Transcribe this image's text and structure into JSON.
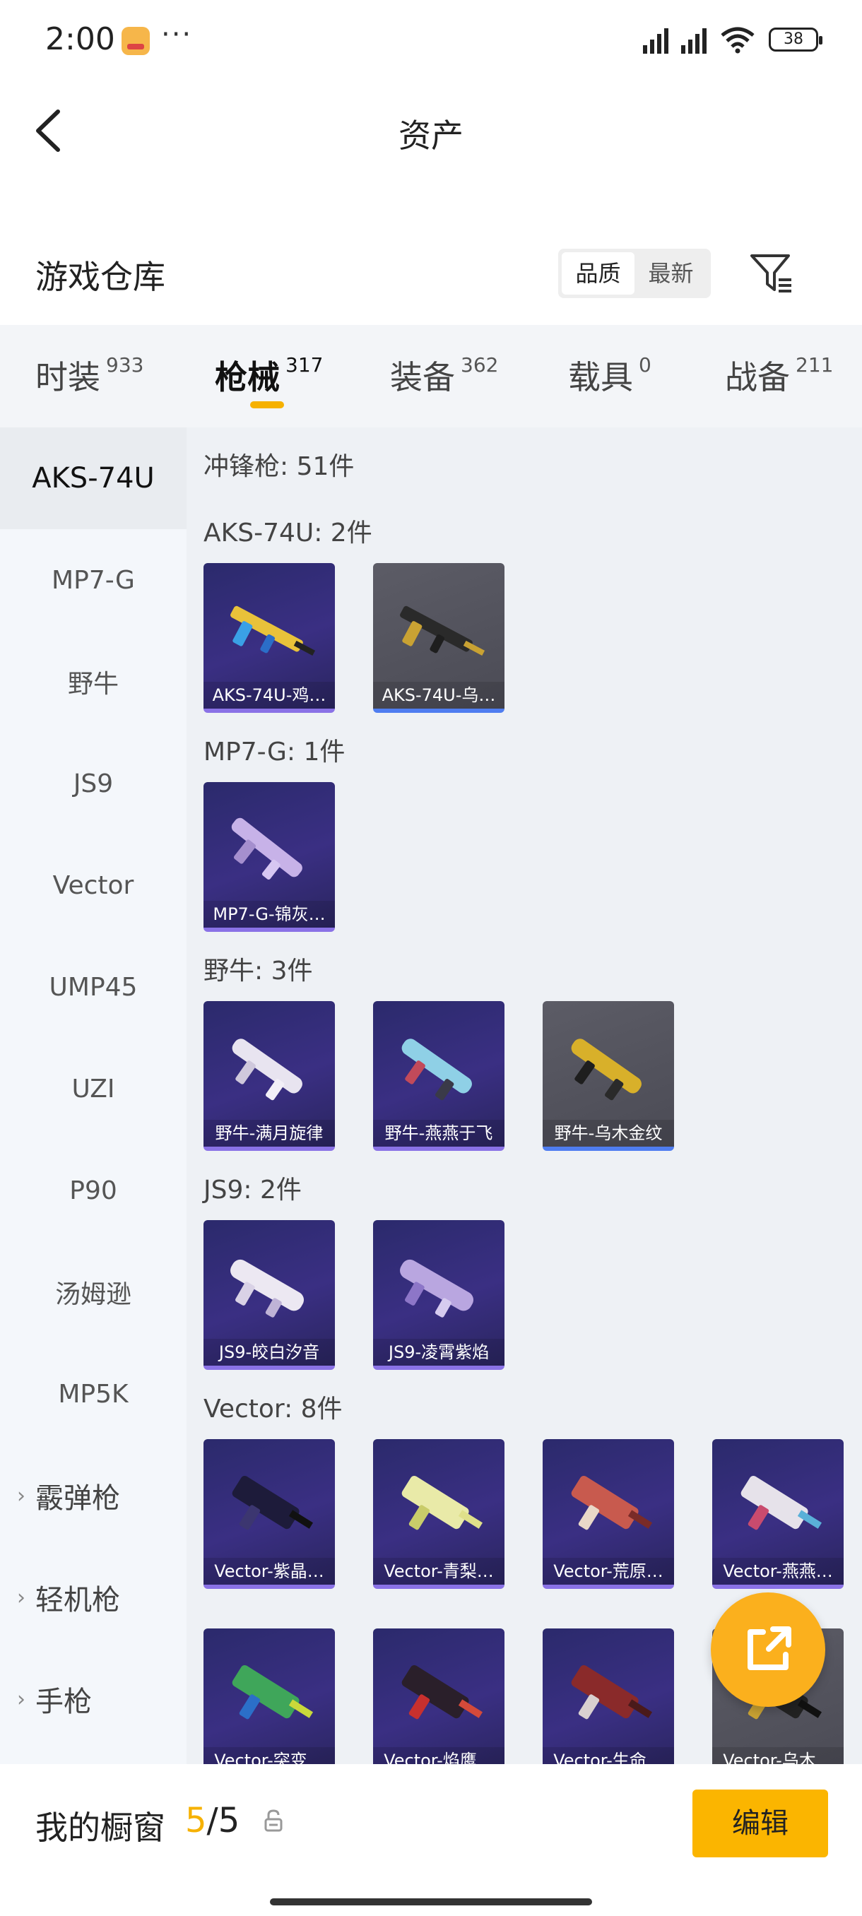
{
  "status": {
    "time": "2:00",
    "dots": "···",
    "battery": "38"
  },
  "header": {
    "title": "资产"
  },
  "warehouse": {
    "title": "游戏仓库",
    "sort_options": [
      "品质",
      "最新"
    ]
  },
  "tabs": [
    {
      "label": "时装",
      "count": "933"
    },
    {
      "label": "枪械",
      "count": "317"
    },
    {
      "label": "装备",
      "count": "362"
    },
    {
      "label": "载具",
      "count": "0"
    },
    {
      "label": "战备",
      "count": "211"
    }
  ],
  "sidebar": {
    "items": [
      "AKS-74U",
      "MP7-G",
      "野牛",
      "JS9",
      "Vector",
      "UMP45",
      "UZI",
      "P90",
      "汤姆逊",
      "MP5K"
    ],
    "groups": [
      "霰弹枪",
      "轻机枪",
      "手枪"
    ]
  },
  "content": {
    "category_title": "冲锋枪: 51件",
    "groups": [
      {
        "label": "AKS-74U: 2件",
        "cards": [
          "AKS-74U-鸡…",
          "AKS-74U-乌…"
        ]
      },
      {
        "label": "MP7-G: 1件",
        "cards": [
          "MP7-G-锦灰…"
        ]
      },
      {
        "label": "野牛: 3件",
        "cards": [
          "野牛-满月旋律",
          "野牛-燕燕于飞",
          "野牛-乌木金纹"
        ]
      },
      {
        "label": "JS9: 2件",
        "cards": [
          "JS9-皎白汐音",
          "JS9-凌霄紫焰"
        ]
      },
      {
        "label": "Vector: 8件",
        "cards": [
          "Vector-紫晶…",
          "Vector-青梨…",
          "Vector-荒原…",
          "Vector-燕燕…",
          "Vector-突变…",
          "Vector-焰鹰…",
          "Vector-生命…",
          "Vector-乌木…"
        ]
      }
    ]
  },
  "bottom": {
    "label": "我的橱窗",
    "current": "5",
    "total": "/5",
    "edit_label": "编辑"
  },
  "colors": {
    "accent": "#fbb500",
    "card_purple": "#2b2a6c",
    "card_gray": "#5c5c66"
  }
}
